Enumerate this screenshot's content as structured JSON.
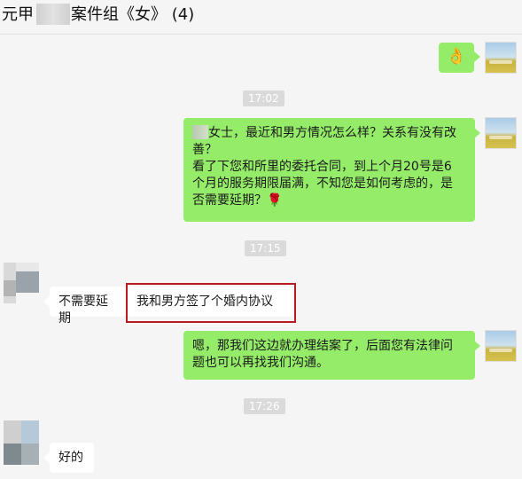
{
  "header": {
    "title_prefix": "元甲",
    "title_suffix": "案件组《女》 (4)"
  },
  "messages": {
    "msg1": {
      "emoji": "👌"
    },
    "time1": "17:02",
    "msg2": {
      "line1": "女士，最近和男方情况怎么样？关系有没有改",
      "line2": "善？",
      "line3": "看了下您和所里的委托合同，到上个月20号是6",
      "line4": "个月的服务期限届满，不知您是如何考虑的，是",
      "line5": "否需要延期？",
      "emoji": "🌹"
    },
    "time2": "17:15",
    "msg3": "不需要延期",
    "msg4": "我和男方签了个婚内协议",
    "msg5": {
      "line1": "嗯，那我们这边就办理结案了，后面您有法律问",
      "line2": "题也可以再找我们沟通。"
    },
    "time3": "17:26",
    "msg6": "好的"
  },
  "colors": {
    "outgoing_bubble": "#95ec69",
    "incoming_bubble": "#ffffff",
    "highlight": "#b81c22"
  }
}
